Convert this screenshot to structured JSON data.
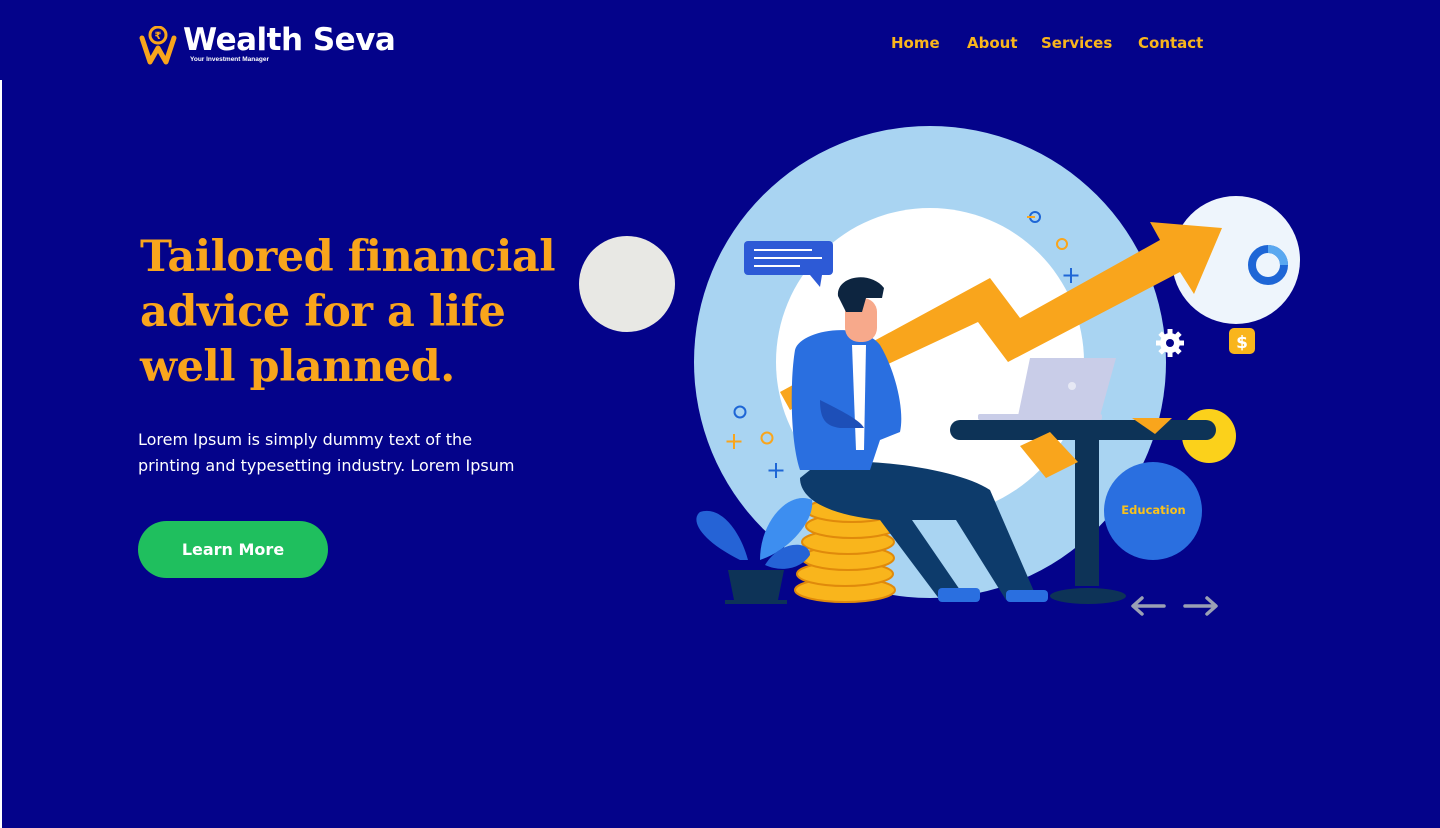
{
  "brand": {
    "name": "Wealth Seva",
    "tagline": "Your Investment Manager",
    "logo_glyph": "₹",
    "accent_color": "#f9a51c"
  },
  "nav": {
    "items": [
      {
        "label": "Home"
      },
      {
        "label": "About"
      },
      {
        "label": "Services"
      },
      {
        "label": "Contact"
      }
    ]
  },
  "hero": {
    "title": "Tailored financial advice for a life well planned.",
    "description": "Lorem Ipsum is simply dummy text of the printing and typesetting industry. Lorem Ipsum",
    "cta_label": "Learn More",
    "cta_color": "#1fbf5e"
  },
  "illustration": {
    "badge_label": "Education",
    "currency_symbol": "$",
    "prev_icon": "arrow-left-icon",
    "next_icon": "arrow-right-icon"
  },
  "colors": {
    "background": "#04038a",
    "nav_text": "#f9b51c",
    "body_text": "#ffffff"
  }
}
